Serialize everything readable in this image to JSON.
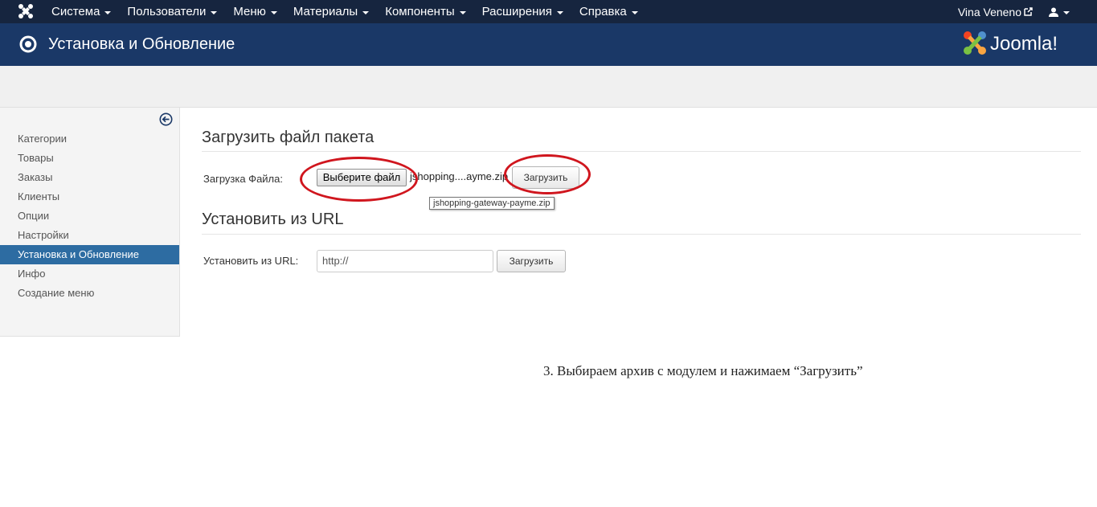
{
  "topnav": {
    "menu": [
      "Система",
      "Пользователи",
      "Меню",
      "Материалы",
      "Компоненты",
      "Расширения",
      "Справка"
    ],
    "user_link": "Vina Veneno"
  },
  "header": {
    "title": "Установка и Обновление",
    "brand": "Joomla!"
  },
  "sidebar": {
    "items": [
      "Категории",
      "Товары",
      "Заказы",
      "Клиенты",
      "Опции",
      "Настройки",
      "Установка и Обновление",
      "Инфо",
      "Создание меню"
    ],
    "active_index": 6
  },
  "upload_section": {
    "title": "Загрузить файл пакета",
    "file_label": "Загрузка Файла:",
    "choose_button": "Выберите файл",
    "selected_file": "jshopping....ayme.zip",
    "tooltip": "jshopping-gateway-payme.zip",
    "upload_button": "Загрузить"
  },
  "url_section": {
    "title": "Установить из URL",
    "url_label": "Установить из URL:",
    "url_value": "http://",
    "upload_button": "Загрузить"
  },
  "caption": "3. Выбираем архив с модулем и нажимаем “Загрузить”",
  "colors": {
    "topnav": "#16253f",
    "header": "#1a3867",
    "active": "#2d6ca2",
    "annotation": "#d0161e"
  }
}
